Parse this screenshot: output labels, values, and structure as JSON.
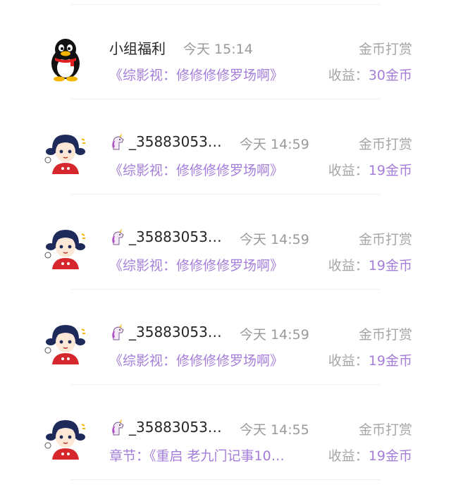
{
  "feed": [
    {
      "name": "小组福利",
      "time": "今天 15:14",
      "tag": "金币打赏",
      "desc": "《综影视：修修修修罗场啊》",
      "income_label": "收益：",
      "income_value": "30金币",
      "avatar": "qq-penguin-icon",
      "name_icon": null
    },
    {
      "name": "_35883053…",
      "time": "今天 14:59",
      "tag": "金币打赏",
      "desc": "《综影视：修修修修罗场啊》",
      "income_label": "收益：",
      "income_value": "19金币",
      "avatar": "cartoon-girl-icon",
      "name_icon": "unicorn-icon"
    },
    {
      "name": "_35883053…",
      "time": "今天 14:59",
      "tag": "金币打赏",
      "desc": "《综影视：修修修修罗场啊》",
      "income_label": "收益：",
      "income_value": "19金币",
      "avatar": "cartoon-girl-icon",
      "name_icon": "unicorn-icon"
    },
    {
      "name": "_35883053…",
      "time": "今天 14:59",
      "tag": "金币打赏",
      "desc": "《综影视：修修修修罗场啊》",
      "income_label": "收益：",
      "income_value": "19金币",
      "avatar": "cartoon-girl-icon",
      "name_icon": "unicorn-icon"
    },
    {
      "name": "_35883053…",
      "time": "今天 14:55",
      "tag": "金币打赏",
      "desc": "章节：《重启 老九门记事10…",
      "income_label": "收益：",
      "income_value": "19金币",
      "avatar": "cartoon-girl-icon",
      "name_icon": "unicorn-icon"
    }
  ],
  "colors": {
    "accent_purple": "#a47ed9",
    "text_primary": "#262626",
    "text_muted": "#9a9a9a"
  }
}
